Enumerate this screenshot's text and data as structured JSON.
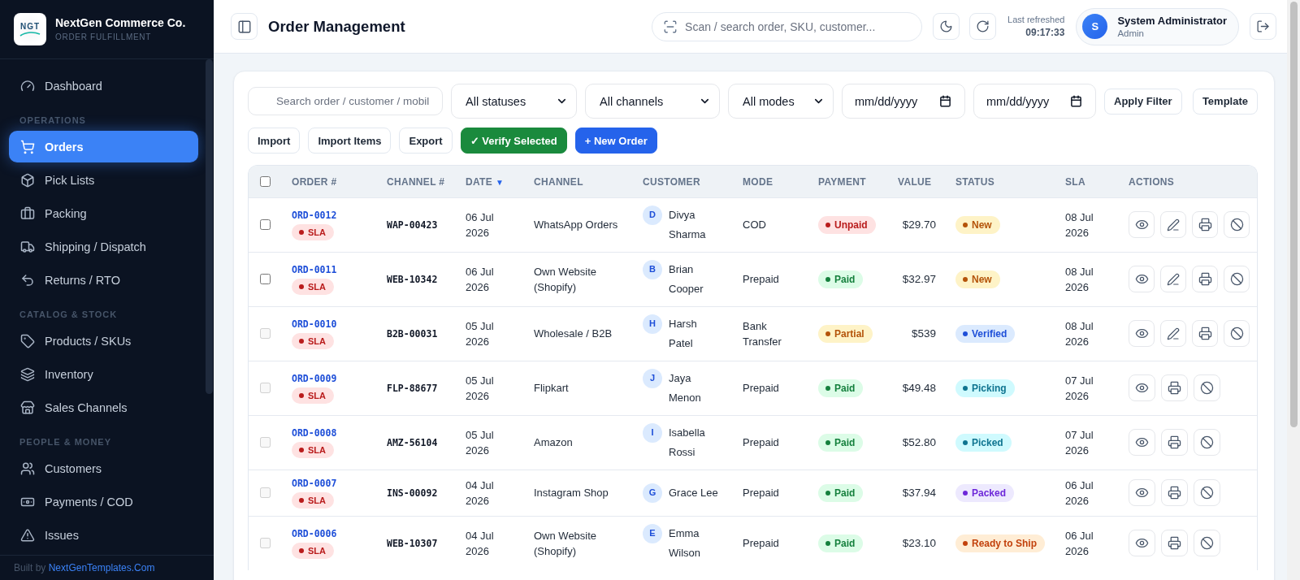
{
  "sidebar": {
    "brand": {
      "logo_text": "NGT",
      "name": "NextGen Commerce Co.",
      "tagline": "ORDER FULFILLMENT"
    },
    "sections": [
      {
        "items": [
          {
            "label": "Dashboard",
            "selected": false
          }
        ]
      },
      {
        "heading": "OPERATIONS",
        "items": [
          {
            "label": "Orders",
            "selected": true
          },
          {
            "label": "Pick Lists",
            "selected": false
          },
          {
            "label": "Packing",
            "selected": false
          },
          {
            "label": "Shipping / Dispatch",
            "selected": false
          },
          {
            "label": "Returns / RTO",
            "selected": false
          }
        ]
      },
      {
        "heading": "CATALOG & STOCK",
        "items": [
          {
            "label": "Products / SKUs",
            "selected": false
          },
          {
            "label": "Inventory",
            "selected": false
          },
          {
            "label": "Sales Channels",
            "selected": false
          }
        ]
      },
      {
        "heading": "PEOPLE & MONEY",
        "items": [
          {
            "label": "Customers",
            "selected": false
          },
          {
            "label": "Payments / COD",
            "selected": false
          },
          {
            "label": "Issues",
            "selected": false
          }
        ]
      }
    ],
    "footer": {
      "text": "Built by",
      "link": "NextGenTemplates.Com"
    }
  },
  "header": {
    "title": "Order Management",
    "search": {
      "placeholder": "Scan / search order, SKU, customer..."
    },
    "refresh": {
      "label": "Last refreshed",
      "time": "09:17:33"
    },
    "user": {
      "initial": "S",
      "name": "System Administrator",
      "role": "Admin"
    }
  },
  "filters": {
    "search": {
      "placeholder": "Search order / customer / mobil"
    },
    "selects": [
      {
        "value": "All statuses"
      },
      {
        "value": "All channels"
      },
      {
        "value": "All modes"
      }
    ],
    "dates": [
      {
        "placeholder": "mm/dd/yyyy"
      },
      {
        "placeholder": "mm/dd/yyyy"
      }
    ],
    "buttons": [
      {
        "label": "Apply Filter"
      },
      {
        "label": "Template"
      }
    ]
  },
  "actions": [
    {
      "label": "Import",
      "kind": "default"
    },
    {
      "label": "Import Items",
      "kind": "default"
    },
    {
      "label": "Export",
      "kind": "default"
    },
    {
      "label": "✓ Verify Selected",
      "kind": "success"
    },
    {
      "label": "+ New Order",
      "kind": "primary"
    }
  ],
  "table": {
    "select_all": {
      "checked": false
    },
    "columns": [
      {
        "label": "ORDER #"
      },
      {
        "label": "CHANNEL #"
      },
      {
        "label": "DATE",
        "sort_mark": "▼"
      },
      {
        "label": "CHANNEL"
      },
      {
        "label": "CUSTOMER"
      },
      {
        "label": "MODE"
      },
      {
        "label": "PAYMENT"
      },
      {
        "label": "VALUE"
      },
      {
        "label": "STATUS"
      },
      {
        "label": "SLA"
      },
      {
        "label": "ACTIONS"
      }
    ],
    "rows": [
      {
        "checked": false,
        "disabled": false,
        "order": "ORD-0012",
        "flag": "SLA",
        "channel_no": "WAP-00423",
        "date": "06 Jul 2026",
        "channel": "WhatsApp Orders",
        "customer": {
          "initial": "D",
          "name": "Divya Sharma"
        },
        "mode": "COD",
        "payment": {
          "label": "Unpaid",
          "kind": "danger"
        },
        "value": "$29.70",
        "status": {
          "label": "New",
          "kind": "warning"
        },
        "sla": "08 Jul 2026",
        "editable": true
      },
      {
        "checked": false,
        "disabled": false,
        "order": "ORD-0011",
        "flag": "SLA",
        "channel_no": "WEB-10342",
        "date": "06 Jul 2026",
        "channel": "Own Website (Shopify)",
        "customer": {
          "initial": "B",
          "name": "Brian Cooper"
        },
        "mode": "Prepaid",
        "payment": {
          "label": "Paid",
          "kind": "success"
        },
        "value": "$32.97",
        "status": {
          "label": "New",
          "kind": "warning"
        },
        "sla": "08 Jul 2026",
        "editable": true
      },
      {
        "checked": false,
        "disabled": true,
        "order": "ORD-0010",
        "flag": "SLA",
        "channel_no": "B2B-00031",
        "date": "05 Jul 2026",
        "channel": "Wholesale / B2B",
        "customer": {
          "initial": "H",
          "name": "Harsh Patel"
        },
        "mode": "Bank Transfer",
        "payment": {
          "label": "Partial",
          "kind": "warning"
        },
        "value": "$539",
        "status": {
          "label": "Verified",
          "kind": "info"
        },
        "sla": "08 Jul 2026",
        "editable": true
      },
      {
        "checked": false,
        "disabled": true,
        "order": "ORD-0009",
        "flag": "SLA",
        "channel_no": "FLP-88677",
        "date": "05 Jul 2026",
        "channel": "Flipkart",
        "customer": {
          "initial": "J",
          "name": "Jaya Menon"
        },
        "mode": "Prepaid",
        "payment": {
          "label": "Paid",
          "kind": "success"
        },
        "value": "$49.48",
        "status": {
          "label": "Picking",
          "kind": "cyan"
        },
        "sla": "07 Jul 2026",
        "editable": false
      },
      {
        "checked": false,
        "disabled": true,
        "order": "ORD-0008",
        "flag": "SLA",
        "channel_no": "AMZ-56104",
        "date": "05 Jul 2026",
        "channel": "Amazon",
        "customer": {
          "initial": "I",
          "name": "Isabella Rossi"
        },
        "mode": "Prepaid",
        "payment": {
          "label": "Paid",
          "kind": "success"
        },
        "value": "$52.80",
        "status": {
          "label": "Picked",
          "kind": "cyan"
        },
        "sla": "07 Jul 2026",
        "editable": false
      },
      {
        "checked": false,
        "disabled": true,
        "order": "ORD-0007",
        "flag": "SLA",
        "channel_no": "INS-00092",
        "date": "04 Jul 2026",
        "channel": "Instagram Shop",
        "customer": {
          "initial": "G",
          "name": "Grace Lee"
        },
        "mode": "Prepaid",
        "payment": {
          "label": "Paid",
          "kind": "success"
        },
        "value": "$37.94",
        "status": {
          "label": "Packed",
          "kind": "violet"
        },
        "sla": "06 Jul 2026",
        "editable": false
      },
      {
        "checked": false,
        "disabled": true,
        "order": "ORD-0006",
        "flag": "SLA",
        "channel_no": "WEB-10307",
        "date": "04 Jul 2026",
        "channel": "Own Website (Shopify)",
        "customer": {
          "initial": "E",
          "name": "Emma Wilson"
        },
        "mode": "Prepaid",
        "payment": {
          "label": "Paid",
          "kind": "success"
        },
        "value": "$23.10",
        "status": {
          "label": "Ready to Ship",
          "kind": "orange"
        },
        "sla": "06 Jul 2026",
        "editable": false
      }
    ]
  }
}
